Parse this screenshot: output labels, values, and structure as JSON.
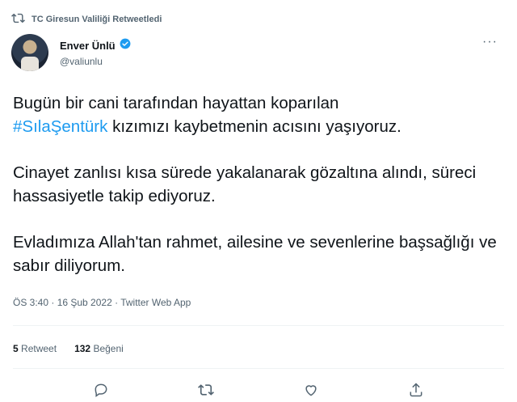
{
  "retweet_bar": {
    "icon": "retweet-icon",
    "label": "TC Giresun Valiliği Retweetledi"
  },
  "author": {
    "display_name": "Enver Ünlü",
    "handle": "@valiunlu",
    "verified_icon": "verified-badge-icon"
  },
  "more_menu": {
    "label": "···"
  },
  "tweet": {
    "para1_line1": "Bugün bir cani tarafından hayattan koparılan",
    "hashtag": "#SılaŞentürk",
    "para1_line2_rest": " kızımızı kaybetmenin acısını yaşıyoruz.",
    "para2": "Cinayet zanlısı kısa sürede yakalanarak gözaltına alındı, süreci hassasiyetle takip ediyoruz.",
    "para3": "Evladımıza Allah'tan rahmet, ailesine ve sevenlerine başsağlığı ve sabır diliyorum."
  },
  "timestamp": "ÖS 3:40 · 16 Şub 2022 · Twitter Web App",
  "stats": {
    "retweet_count": "5",
    "retweet_label": "Retweet",
    "like_count": "132",
    "like_label": "Beğeni"
  },
  "colors": {
    "accent": "#1d9bf0",
    "text": "#0f1419",
    "secondary": "#536471"
  }
}
